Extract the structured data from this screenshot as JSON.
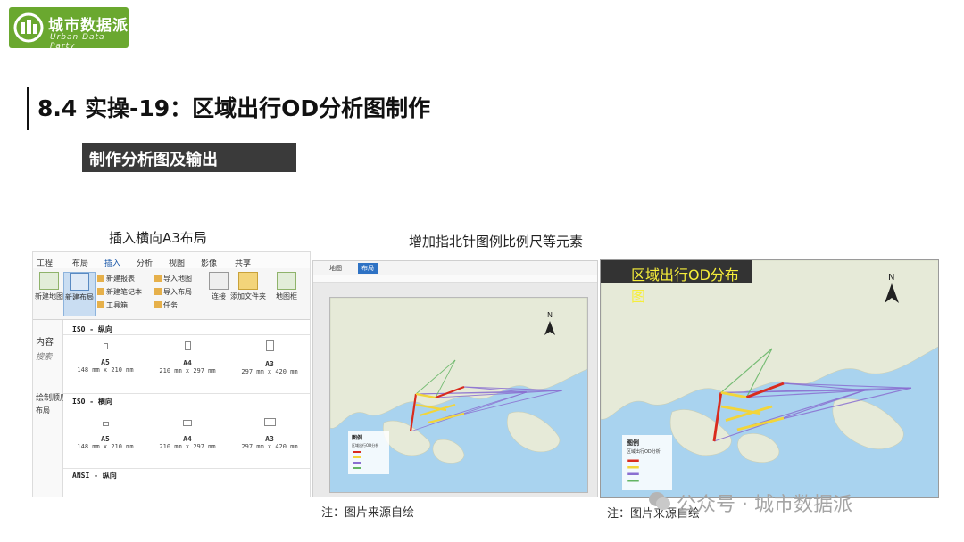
{
  "brand": {
    "name": "城市数据派",
    "sub": "Urban Data Party",
    "color": "#6aa82f"
  },
  "heading": {
    "title": "8.4 实操-19：区域出行OD分析图制作",
    "subtitle": "制作分析图及输出"
  },
  "panels": [
    {
      "caption": "插入横向A3布局"
    },
    {
      "caption": "增加指北针图例比例尺等元素",
      "note": "注：图片来源自绘"
    },
    {
      "caption": "区域出行OD分布图",
      "note": "注：图片来源自绘"
    }
  ],
  "ribbon": {
    "tabs": [
      "工程",
      "布局",
      "插入",
      "分析",
      "视图",
      "影像",
      "共享"
    ],
    "active_tab": "插入",
    "new_map": "新建地图",
    "new_layout": "新建布局",
    "new_report": "新建报表",
    "new_notebook": "新建笔记本",
    "toolbox": "工具箱",
    "import_map": "导入地图",
    "import_layout": "导入布局",
    "task": "任务",
    "connect": "连接",
    "add_folder": "添加文件夹",
    "map_frame": "地图框"
  },
  "contents_pane": {
    "title": "内容",
    "search": "搜索",
    "drawing_order": "绘制顺序",
    "layout_item": "布局"
  },
  "layout_gallery": {
    "portrait_header": "ISO - 纵向",
    "landscape_header": "ISO - 横向",
    "ansi_header": "ANSI - 纵向",
    "sizes": [
      {
        "name": "A5",
        "dims": "148 mm x 210 mm"
      },
      {
        "name": "A4",
        "dims": "210 mm x 297 mm"
      },
      {
        "name": "A3",
        "dims": "297 mm x 420 mm"
      }
    ]
  },
  "layout_view": {
    "tabs": [
      "地图",
      "布局"
    ],
    "active": "布局"
  },
  "map": {
    "north_label": "N",
    "legend_title": "图例",
    "legend_subtitle": "区域出行OD分析",
    "water_color": "#a9d3ef",
    "land_color": "#e6ead8",
    "od_colors": [
      "#d92b1e",
      "#f2d53a",
      "#8a6fd1",
      "#63b463"
    ]
  },
  "watermark": "公众号 · 城市数据派"
}
